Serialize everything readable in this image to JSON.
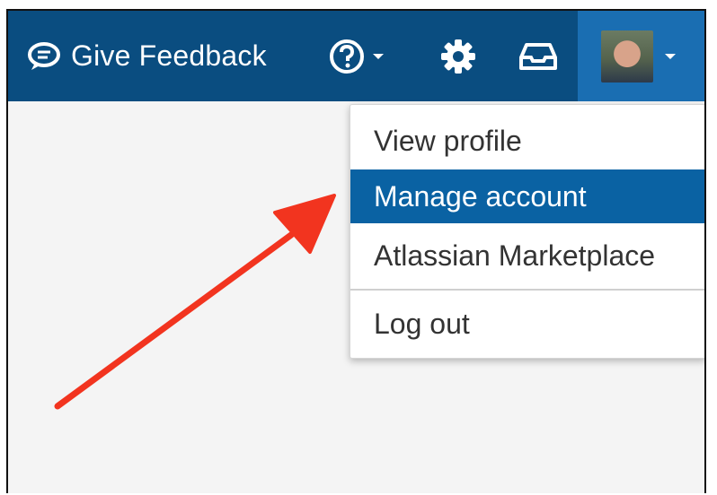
{
  "header": {
    "feedback_label": "Give Feedback"
  },
  "user_menu": {
    "items": [
      {
        "label": "View profile"
      },
      {
        "label": "Manage account",
        "highlighted": true
      },
      {
        "label": "Atlassian Marketplace"
      },
      {
        "label": "Log out"
      }
    ]
  },
  "colors": {
    "topbar": "#0a4d80",
    "active_tab": "#1a6eb2",
    "highlight": "#0a62a3",
    "arrow": "#f2341f"
  },
  "icons": [
    "feedback-bubble-icon",
    "help-icon",
    "chevron-down-icon",
    "gear-icon",
    "inbox-icon",
    "avatar"
  ]
}
